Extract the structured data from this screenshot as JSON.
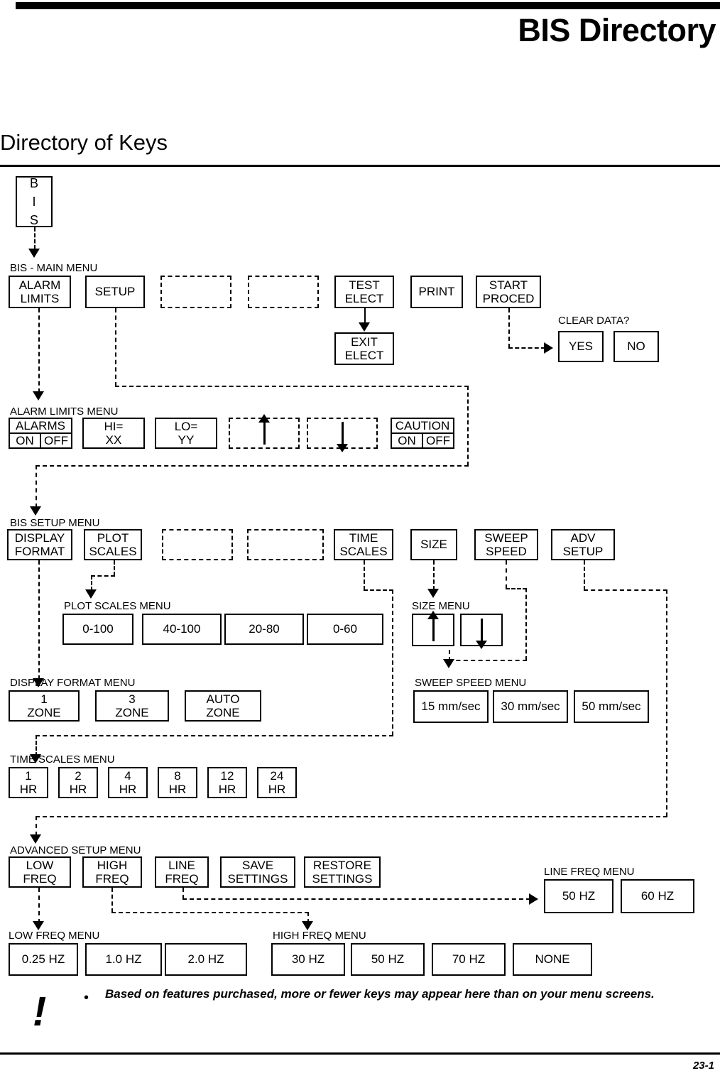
{
  "header": {
    "doc_title": "BIS Directory",
    "section_title": "Directory of Keys"
  },
  "footer": {
    "page_number": "23-1"
  },
  "note": {
    "bang_icon": "warning-exclamation",
    "bullet": "•",
    "text": "Based on features purchased, more or fewer keys may appear here than on your menu screens."
  },
  "root_key": {
    "label": "B\nI\nS"
  },
  "menus": {
    "main": {
      "caption": "BIS - MAIN MENU",
      "keys": [
        {
          "label": "ALARM\nLIMITS",
          "blank": false
        },
        {
          "label": "SETUP",
          "blank": false
        },
        {
          "label": "",
          "blank": true
        },
        {
          "label": "",
          "blank": true
        },
        {
          "label": "TEST\nELECT",
          "blank": false
        },
        {
          "label": "PRINT",
          "blank": false
        },
        {
          "label": "START\nPROCED",
          "blank": false
        }
      ]
    },
    "test_elect_child": {
      "label": "EXIT\nELECT"
    },
    "clear_data": {
      "caption": "CLEAR DATA?",
      "keys": [
        {
          "label": "YES"
        },
        {
          "label": "NO"
        }
      ]
    },
    "alarm_limits": {
      "caption": "ALARM LIMITS MENU",
      "keys": [
        {
          "type": "split",
          "title": "ALARMS",
          "left": "ON",
          "right": "OFF"
        },
        {
          "type": "plain",
          "label": "HI=\nXX"
        },
        {
          "type": "plain",
          "label": "LO=\nYY"
        },
        {
          "type": "blank-arrow",
          "icon": "arrow-up-icon"
        },
        {
          "type": "blank-arrow",
          "icon": "arrow-down-icon"
        },
        {
          "type": "split",
          "title": "CAUTION",
          "left": "ON",
          "right": "OFF"
        }
      ]
    },
    "bis_setup": {
      "caption": "BIS SETUP MENU",
      "keys": [
        {
          "label": "DISPLAY\nFORMAT",
          "blank": false
        },
        {
          "label": "PLOT\nSCALES",
          "blank": false
        },
        {
          "label": "",
          "blank": true
        },
        {
          "label": "",
          "blank": true
        },
        {
          "label": "TIME\nSCALES",
          "blank": false
        },
        {
          "label": "SIZE",
          "blank": false
        },
        {
          "label": "SWEEP\nSPEED",
          "blank": false
        },
        {
          "label": "ADV\nSETUP",
          "blank": false
        }
      ]
    },
    "plot_scales": {
      "caption": "PLOT SCALES MENU",
      "keys": [
        {
          "label": "0-100"
        },
        {
          "label": "40-100"
        },
        {
          "label": "20-80"
        },
        {
          "label": "0-60"
        }
      ]
    },
    "size": {
      "caption": "SIZE MENU",
      "keys": [
        {
          "icon": "arrow-up-icon"
        },
        {
          "icon": "arrow-down-icon"
        }
      ]
    },
    "display_format": {
      "caption": "DISPLAY FORMAT MENU",
      "keys": [
        {
          "label": "1\nZONE"
        },
        {
          "label": "3\nZONE"
        },
        {
          "label": "AUTO\nZONE"
        }
      ]
    },
    "sweep_speed": {
      "caption": "SWEEP SPEED MENU",
      "keys": [
        {
          "label": "15 mm/sec"
        },
        {
          "label": "30 mm/sec"
        },
        {
          "label": "50 mm/sec"
        }
      ]
    },
    "time_scales": {
      "caption": "TIME SCALES MENU",
      "keys": [
        {
          "label": "1\nHR"
        },
        {
          "label": "2\nHR"
        },
        {
          "label": "4\nHR"
        },
        {
          "label": "8\nHR"
        },
        {
          "label": "12\nHR"
        },
        {
          "label": "24\nHR"
        }
      ]
    },
    "advanced_setup": {
      "caption": "ADVANCED SETUP MENU",
      "keys": [
        {
          "label": "LOW\nFREQ"
        },
        {
          "label": "HIGH\nFREQ"
        },
        {
          "label": "LINE\nFREQ"
        },
        {
          "label": "SAVE\nSETTINGS"
        },
        {
          "label": "RESTORE\nSETTINGS"
        }
      ]
    },
    "line_freq": {
      "caption": "LINE FREQ MENU",
      "keys": [
        {
          "label": "50 HZ"
        },
        {
          "label": "60 HZ"
        }
      ]
    },
    "low_freq": {
      "caption": "LOW FREQ MENU",
      "keys": [
        {
          "label": "0.25 HZ"
        },
        {
          "label": "1.0 HZ"
        },
        {
          "label": "2.0 HZ"
        }
      ]
    },
    "high_freq": {
      "caption": "HIGH FREQ MENU",
      "keys": [
        {
          "label": "30 HZ"
        },
        {
          "label": "50 HZ"
        },
        {
          "label": "70 HZ"
        },
        {
          "label": "NONE"
        }
      ]
    }
  }
}
